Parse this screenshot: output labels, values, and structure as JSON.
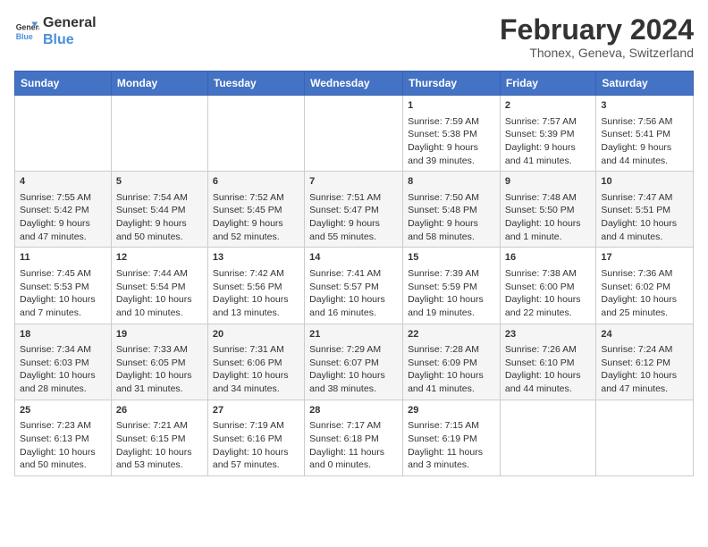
{
  "header": {
    "logo_line1": "General",
    "logo_line2": "Blue",
    "month_year": "February 2024",
    "location": "Thonex, Geneva, Switzerland"
  },
  "columns": [
    "Sunday",
    "Monday",
    "Tuesday",
    "Wednesday",
    "Thursday",
    "Friday",
    "Saturday"
  ],
  "weeks": [
    [
      {
        "day": "",
        "content": ""
      },
      {
        "day": "",
        "content": ""
      },
      {
        "day": "",
        "content": ""
      },
      {
        "day": "",
        "content": ""
      },
      {
        "day": "1",
        "content": "Sunrise: 7:59 AM\nSunset: 5:38 PM\nDaylight: 9 hours\nand 39 minutes."
      },
      {
        "day": "2",
        "content": "Sunrise: 7:57 AM\nSunset: 5:39 PM\nDaylight: 9 hours\nand 41 minutes."
      },
      {
        "day": "3",
        "content": "Sunrise: 7:56 AM\nSunset: 5:41 PM\nDaylight: 9 hours\nand 44 minutes."
      }
    ],
    [
      {
        "day": "4",
        "content": "Sunrise: 7:55 AM\nSunset: 5:42 PM\nDaylight: 9 hours\nand 47 minutes."
      },
      {
        "day": "5",
        "content": "Sunrise: 7:54 AM\nSunset: 5:44 PM\nDaylight: 9 hours\nand 50 minutes."
      },
      {
        "day": "6",
        "content": "Sunrise: 7:52 AM\nSunset: 5:45 PM\nDaylight: 9 hours\nand 52 minutes."
      },
      {
        "day": "7",
        "content": "Sunrise: 7:51 AM\nSunset: 5:47 PM\nDaylight: 9 hours\nand 55 minutes."
      },
      {
        "day": "8",
        "content": "Sunrise: 7:50 AM\nSunset: 5:48 PM\nDaylight: 9 hours\nand 58 minutes."
      },
      {
        "day": "9",
        "content": "Sunrise: 7:48 AM\nSunset: 5:50 PM\nDaylight: 10 hours\nand 1 minute."
      },
      {
        "day": "10",
        "content": "Sunrise: 7:47 AM\nSunset: 5:51 PM\nDaylight: 10 hours\nand 4 minutes."
      }
    ],
    [
      {
        "day": "11",
        "content": "Sunrise: 7:45 AM\nSunset: 5:53 PM\nDaylight: 10 hours\nand 7 minutes."
      },
      {
        "day": "12",
        "content": "Sunrise: 7:44 AM\nSunset: 5:54 PM\nDaylight: 10 hours\nand 10 minutes."
      },
      {
        "day": "13",
        "content": "Sunrise: 7:42 AM\nSunset: 5:56 PM\nDaylight: 10 hours\nand 13 minutes."
      },
      {
        "day": "14",
        "content": "Sunrise: 7:41 AM\nSunset: 5:57 PM\nDaylight: 10 hours\nand 16 minutes."
      },
      {
        "day": "15",
        "content": "Sunrise: 7:39 AM\nSunset: 5:59 PM\nDaylight: 10 hours\nand 19 minutes."
      },
      {
        "day": "16",
        "content": "Sunrise: 7:38 AM\nSunset: 6:00 PM\nDaylight: 10 hours\nand 22 minutes."
      },
      {
        "day": "17",
        "content": "Sunrise: 7:36 AM\nSunset: 6:02 PM\nDaylight: 10 hours\nand 25 minutes."
      }
    ],
    [
      {
        "day": "18",
        "content": "Sunrise: 7:34 AM\nSunset: 6:03 PM\nDaylight: 10 hours\nand 28 minutes."
      },
      {
        "day": "19",
        "content": "Sunrise: 7:33 AM\nSunset: 6:05 PM\nDaylight: 10 hours\nand 31 minutes."
      },
      {
        "day": "20",
        "content": "Sunrise: 7:31 AM\nSunset: 6:06 PM\nDaylight: 10 hours\nand 34 minutes."
      },
      {
        "day": "21",
        "content": "Sunrise: 7:29 AM\nSunset: 6:07 PM\nDaylight: 10 hours\nand 38 minutes."
      },
      {
        "day": "22",
        "content": "Sunrise: 7:28 AM\nSunset: 6:09 PM\nDaylight: 10 hours\nand 41 minutes."
      },
      {
        "day": "23",
        "content": "Sunrise: 7:26 AM\nSunset: 6:10 PM\nDaylight: 10 hours\nand 44 minutes."
      },
      {
        "day": "24",
        "content": "Sunrise: 7:24 AM\nSunset: 6:12 PM\nDaylight: 10 hours\nand 47 minutes."
      }
    ],
    [
      {
        "day": "25",
        "content": "Sunrise: 7:23 AM\nSunset: 6:13 PM\nDaylight: 10 hours\nand 50 minutes."
      },
      {
        "day": "26",
        "content": "Sunrise: 7:21 AM\nSunset: 6:15 PM\nDaylight: 10 hours\nand 53 minutes."
      },
      {
        "day": "27",
        "content": "Sunrise: 7:19 AM\nSunset: 6:16 PM\nDaylight: 10 hours\nand 57 minutes."
      },
      {
        "day": "28",
        "content": "Sunrise: 7:17 AM\nSunset: 6:18 PM\nDaylight: 11 hours\nand 0 minutes."
      },
      {
        "day": "29",
        "content": "Sunrise: 7:15 AM\nSunset: 6:19 PM\nDaylight: 11 hours\nand 3 minutes."
      },
      {
        "day": "",
        "content": ""
      },
      {
        "day": "",
        "content": ""
      }
    ]
  ]
}
